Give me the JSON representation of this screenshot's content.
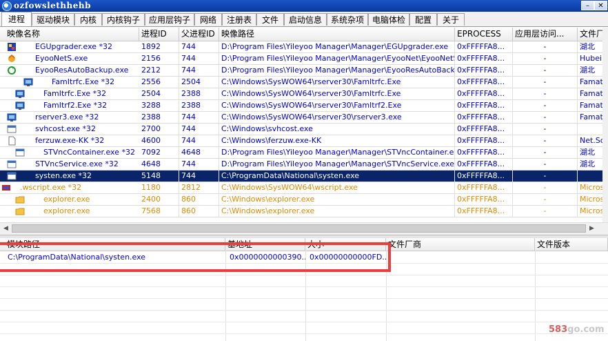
{
  "window": {
    "title": "ozfowslethhehb"
  },
  "tabs": [
    "进程",
    "驱动模块",
    "内核",
    "内核钩子",
    "应用层钩子",
    "网络",
    "注册表",
    "文件",
    "启动信息",
    "系统杂项",
    "电脑体检",
    "配置",
    "关于"
  ],
  "process_columns": [
    "映像名称",
    "进程ID",
    "父进程ID",
    "映像路径",
    "EPROCESS",
    "应用层访问...",
    "文件厂"
  ],
  "processes": [
    {
      "name": "EGUpgrader.exe *32",
      "pid": "1892",
      "ppid": "744",
      "path": "D:\\Program Files\\Yileyoo Manager\\Manager\\EGUpgrader.exe",
      "eprocess": "0xFFFFFA8...",
      "access": "-",
      "vendor": "湖北",
      "color": "#0000cc",
      "icon": "eg-icon",
      "indent": 40
    },
    {
      "name": "EyooNetS.exe",
      "pid": "2156",
      "ppid": "744",
      "path": "D:\\Program Files\\Yileyoo Manager\\Manager\\EyooNet\\EyooNetS.exe",
      "eprocess": "0xFFFFFA8...",
      "access": "-",
      "vendor": "Hubei",
      "color": "#0000cc",
      "icon": "bird-icon",
      "indent": 40
    },
    {
      "name": "EyooResAutoBackup.exe",
      "pid": "2212",
      "ppid": "744",
      "path": "D:\\Program Files\\Yileyoo Manager\\Manager\\EyooResAutoBackup....",
      "eprocess": "0xFFFFFA8...",
      "access": "-",
      "vendor": "湖北",
      "color": "#0000cc",
      "icon": "backup-icon",
      "indent": 40
    },
    {
      "name": "FamItrfc.Exe *32",
      "pid": "2556",
      "ppid": "2504",
      "path": "C:\\Windows\\SysWOW64\\rserver30\\FamItrfc.Exe",
      "eprocess": "0xFFFFFA8...",
      "access": "-",
      "vendor": "Famate",
      "color": "#0000cc",
      "icon": "monitor-icon",
      "indent": 64
    },
    {
      "name": "FamItrfc.Exe *32",
      "pid": "2504",
      "ppid": "2388",
      "path": "C:\\Windows\\SysWOW64\\rserver30\\FamItrfc.Exe",
      "eprocess": "0xFFFFFA8...",
      "access": "-",
      "vendor": "Famate",
      "color": "#0000cc",
      "icon": "monitor-icon",
      "indent": 52
    },
    {
      "name": "FamItrf2.Exe *32",
      "pid": "3288",
      "ppid": "2388",
      "path": "C:\\Windows\\SysWOW64\\rserver30\\FamItrf2.Exe",
      "eprocess": "0xFFFFFA8...",
      "access": "-",
      "vendor": "Famate",
      "color": "#0000cc",
      "icon": "monitor-icon",
      "indent": 52
    },
    {
      "name": "rserver3.exe *32",
      "pid": "2388",
      "ppid": "744",
      "path": "C:\\Windows\\SysWOW64\\rserver30\\rserver3.exe",
      "eprocess": "0xFFFFFA8...",
      "access": "-",
      "vendor": "Famate",
      "color": "#0000cc",
      "icon": "monitor-icon",
      "indent": 40
    },
    {
      "name": "svhcost.exe *32",
      "pid": "2700",
      "ppid": "744",
      "path": "C:\\Windows\\svhcost.exe",
      "eprocess": "0xFFFFFA8...",
      "access": "-",
      "vendor": "",
      "color": "#0000cc",
      "icon": "window-icon",
      "indent": 40
    },
    {
      "name": "ferzuw.exe-KK *32",
      "pid": "4600",
      "ppid": "744",
      "path": "C:\\Windows\\ferzuw.exe-KK",
      "eprocess": "0xFFFFFA8...",
      "access": "-",
      "vendor": "Net.So",
      "color": "#0000cc",
      "icon": "file-icon",
      "indent": 40
    },
    {
      "name": "STVncContainer.exe *32",
      "pid": "7092",
      "ppid": "4648",
      "path": "D:\\Program Files\\Yileyoo Manager\\Manager\\STVncContainer.exe",
      "eprocess": "0xFFFFFA8...",
      "access": "-",
      "vendor": "湖北",
      "color": "#0000cc",
      "icon": "window-icon",
      "indent": 52
    },
    {
      "name": "STVncService.exe *32",
      "pid": "4648",
      "ppid": "744",
      "path": "D:\\Program Files\\Yileyoo Manager\\Manager\\STVncService.exe",
      "eprocess": "0xFFFFFA8...",
      "access": "-",
      "vendor": "湖北",
      "color": "#0000cc",
      "icon": "window-icon",
      "indent": 40
    },
    {
      "name": "systen.exe *32",
      "pid": "5148",
      "ppid": "744",
      "path": "C:\\ProgramData\\National\\systen.exe",
      "eprocess": "0xFFFFFA8...",
      "access": "-",
      "vendor": "",
      "color": "#0000cc",
      "icon": "window-icon",
      "indent": 40,
      "selected": true
    },
    {
      "name": ".wscript.exe *32",
      "pid": "1180",
      "ppid": "2812",
      "path": "C:\\Windows\\SysWOW64\\wscript.exe",
      "eprocess": "0xFFFFFA8...",
      "access": "-",
      "vendor": "Micros",
      "color": "#e08a00",
      "icon": "script-icon",
      "indent": 18
    },
    {
      "name": "explorer.exe",
      "pid": "2400",
      "ppid": "860",
      "path": "C:\\Windows\\explorer.exe",
      "eprocess": "0xFFFFFA8...",
      "access": "-",
      "vendor": "Micros",
      "color": "#e08a00",
      "icon": "folder-icon",
      "indent": 52
    },
    {
      "name": "explorer.exe",
      "pid": "7568",
      "ppid": "860",
      "path": "C:\\Windows\\explorer.exe",
      "eprocess": "0xFFFFFA8...",
      "access": "-",
      "vendor": "Micros",
      "color": "#e08a00",
      "icon": "folder-icon",
      "indent": 52
    }
  ],
  "module_columns": [
    "模块路径",
    "基地址",
    "大小",
    "文件厂商",
    "文件版本"
  ],
  "modules": [
    {
      "path": "C:\\ProgramData\\National\\systen.exe",
      "base": "0x0000000000390...",
      "size": "0x00000000000FD...",
      "vendor": "",
      "version": ""
    }
  ],
  "watermark": {
    "num": "583",
    "rest": "go.com"
  },
  "colors": {
    "selected": "#0a246a",
    "normal": "#0000cc",
    "microsoft": "#e08a00",
    "highlight": "#ee3b3b"
  }
}
